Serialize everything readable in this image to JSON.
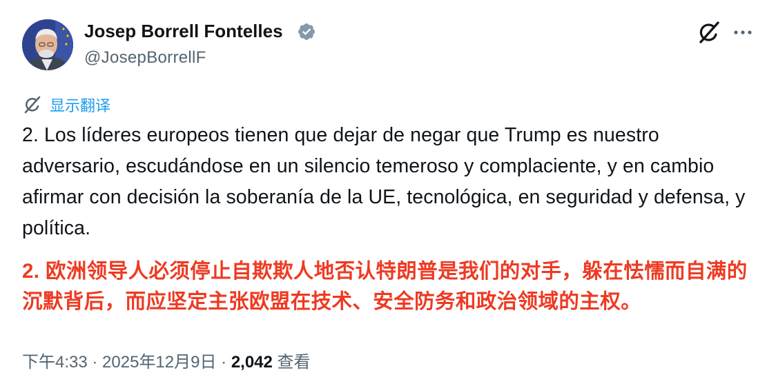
{
  "author": {
    "display_name": "Josep Borrell Fontelles",
    "handle": "@JosepBorrellF",
    "verified_icon": "verified-badge-icon"
  },
  "actions": {
    "grok_icon": "grok-icon",
    "more_icon": "more-dots-icon"
  },
  "translate": {
    "label": "显示翻译",
    "icon": "grok-icon"
  },
  "tweet": {
    "text": "2. Los líderes europeos tienen que dejar de negar que Trump es nuestro adversario, escudándose en un silencio temeroso y complaciente, y en cambio afirmar con decisión la soberanía de la UE, tecnológica,  en seguridad y defensa, y política.",
    "translation_overlay": "2. 欧洲领导人必须停止自欺欺人地否认特朗普是我们的对手，躲在怯懦而自满的沉默背后，而应坚定主张欧盟在技术、安全防务和政治领域的主权。"
  },
  "meta": {
    "time": "下午4:33",
    "separator": " · ",
    "date": "2025年12月9日",
    "views_count": "2,042",
    "views_label": " 查看"
  },
  "colors": {
    "accent": "#1d9bf0",
    "secondary_text": "#536471",
    "overlay_red": "#ee3a22"
  }
}
